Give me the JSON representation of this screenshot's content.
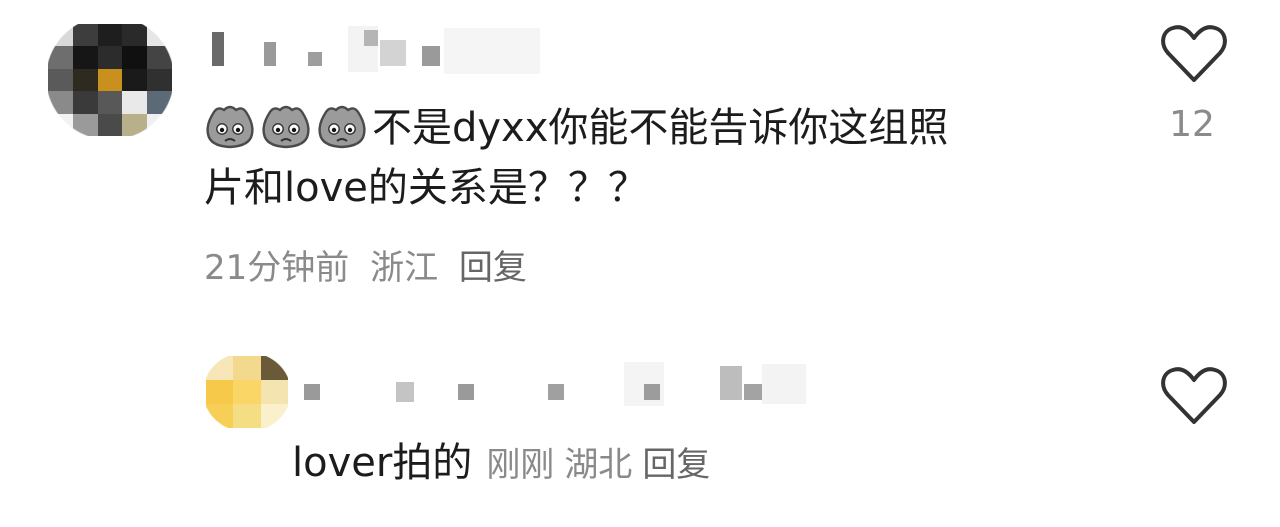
{
  "comment": {
    "avatar_alt": "blurred avatar",
    "username_alt": "blurred username",
    "emojis": [
      "pouting-face-emoji",
      "pouting-face-emoji",
      "pouting-face-emoji"
    ],
    "text": "不是dyxx你能不能告诉你这组照\n片和love的关系是？？？",
    "time": "21分钟前",
    "location": "浙江",
    "reply_label": "回复",
    "like_icon": "heart-outline-icon",
    "like_count": "12"
  },
  "reply": {
    "avatar_alt": "blurred avatar",
    "username_alt": "blurred username",
    "text": "lover拍的",
    "time": "刚刚",
    "location": "湖北",
    "reply_label": "回复",
    "like_icon": "heart-outline-icon"
  },
  "colors": {
    "text_primary": "#1c1c1c",
    "text_secondary": "#8a8a8a",
    "reply_action": "#666666",
    "icon_stroke": "#333333"
  }
}
